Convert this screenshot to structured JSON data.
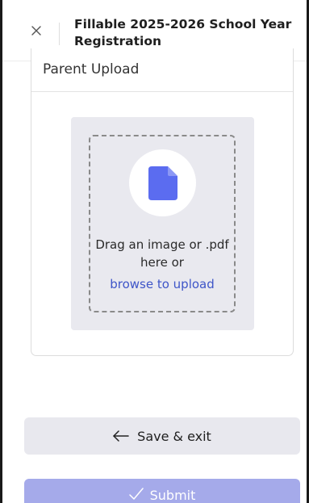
{
  "header": {
    "title": "Fillable 2025-2026 School Year Registration",
    "close_icon": "close-icon"
  },
  "section": {
    "label": "Parent Upload"
  },
  "upload": {
    "icon": "file-icon",
    "drag_text": "Drag an image or .pdf here or",
    "browse_link": "browse to upload"
  },
  "actions": {
    "save_label": "Save & exit",
    "save_icon": "arrow-left-icon",
    "submit_label": "Submit",
    "submit_icon": "checkmark-icon"
  },
  "colors": {
    "accent": "#3e55c8",
    "file_icon": "#5b6cf0",
    "submit_bg": "#a5aaea",
    "save_bg": "#e8e8ee",
    "upload_bg": "#e9e9ef"
  }
}
